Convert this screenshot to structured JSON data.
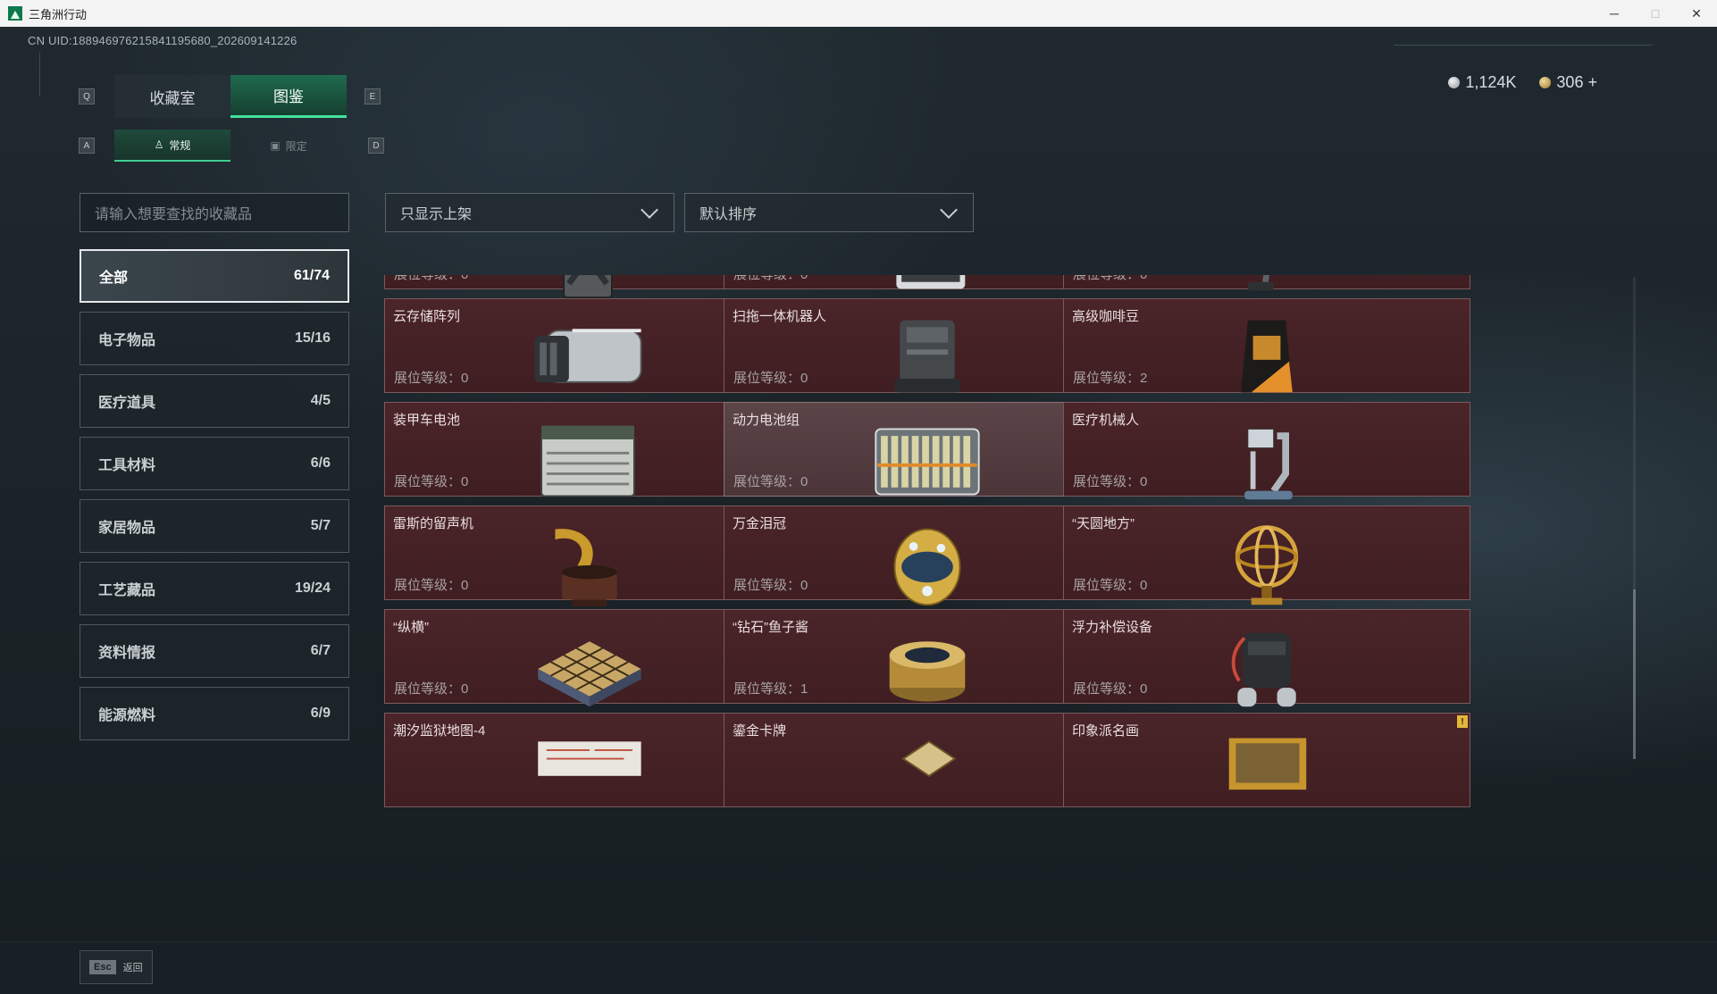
{
  "window": {
    "title": "三角洲行动",
    "minimize": "─",
    "maximize": "□",
    "close": "✕"
  },
  "uid": "CN UID:1889469762158411956​80_202609141226",
  "currency": {
    "silver": "1,124K",
    "gold": "306",
    "add": "+"
  },
  "keys": {
    "prev_tab": "Q",
    "next_tab": "E",
    "prev_sub": "A",
    "next_sub": "D"
  },
  "tabs": [
    {
      "label": "收藏室"
    },
    {
      "label": "图鉴"
    }
  ],
  "subtabs": [
    {
      "label": "常规",
      "icon": "bag-icon"
    },
    {
      "label": "限定",
      "icon": "image-icon"
    }
  ],
  "search": {
    "placeholder": "请输入想要查找的收藏品"
  },
  "filter": {
    "value": "只显示上架"
  },
  "sort": {
    "value": "默认排序"
  },
  "categories": [
    {
      "label": "全部",
      "count": "61/74"
    },
    {
      "label": "电子物品",
      "count": "15/16"
    },
    {
      "label": "医疗道具",
      "count": "4/5"
    },
    {
      "label": "工具材料",
      "count": "6/6"
    },
    {
      "label": "家居物品",
      "count": "5/7"
    },
    {
      "label": "工艺藏品",
      "count": "19/24"
    },
    {
      "label": "资料情报",
      "count": "6/7"
    },
    {
      "label": "能源燃料",
      "count": "6/9"
    }
  ],
  "level_label": "展位等级：",
  "items": [
    {
      "name": "",
      "level": "0",
      "icon": "fuel-can-icon",
      "badge": false
    },
    {
      "name": "",
      "level": "0",
      "icon": "terminal-device-icon",
      "badge": false
    },
    {
      "name": "",
      "level": "0",
      "icon": "floor-washer-icon",
      "badge": false
    },
    {
      "name": "云存储阵列",
      "level": "0",
      "icon": "server-array-icon",
      "badge": true
    },
    {
      "name": "扫拖一体机器人",
      "level": "0",
      "icon": "robot-mop-icon",
      "badge": true
    },
    {
      "name": "高级咖啡豆",
      "level": "2",
      "icon": "coffee-bag-icon",
      "badge": false
    },
    {
      "name": "装甲车电池",
      "level": "0",
      "icon": "battery-icon",
      "badge": false
    },
    {
      "name": "动力电池组",
      "level": "0",
      "icon": "battery-pack-icon",
      "badge": false
    },
    {
      "name": "医疗机械人",
      "level": "0",
      "icon": "medical-robot-icon",
      "badge": false
    },
    {
      "name": "雷斯的留声机",
      "level": "0",
      "icon": "gramophone-icon",
      "badge": false
    },
    {
      "name": "万金泪冠",
      "level": "0",
      "icon": "jeweled-egg-icon",
      "badge": true
    },
    {
      "name": "“天圆地方”",
      "level": "0",
      "icon": "armillary-sphere-icon",
      "badge": false
    },
    {
      "name": "“纵横”",
      "level": "0",
      "icon": "chess-board-icon",
      "badge": false
    },
    {
      "name": "“钻石”鱼子酱",
      "level": "1",
      "icon": "caviar-tin-icon",
      "badge": false
    },
    {
      "name": "浮力补偿设备",
      "level": "0",
      "icon": "diving-gear-icon",
      "badge": false
    },
    {
      "name": "潮汐监狱地图-4",
      "level": "",
      "icon": "map-icon",
      "badge": false
    },
    {
      "name": "鎏金卡牌",
      "level": "",
      "icon": "card-icon",
      "badge": false
    },
    {
      "name": "印象派名画",
      "level": "",
      "icon": "painting-icon",
      "badge": true
    }
  ],
  "footer": {
    "key": "Esc",
    "label": "返回"
  }
}
